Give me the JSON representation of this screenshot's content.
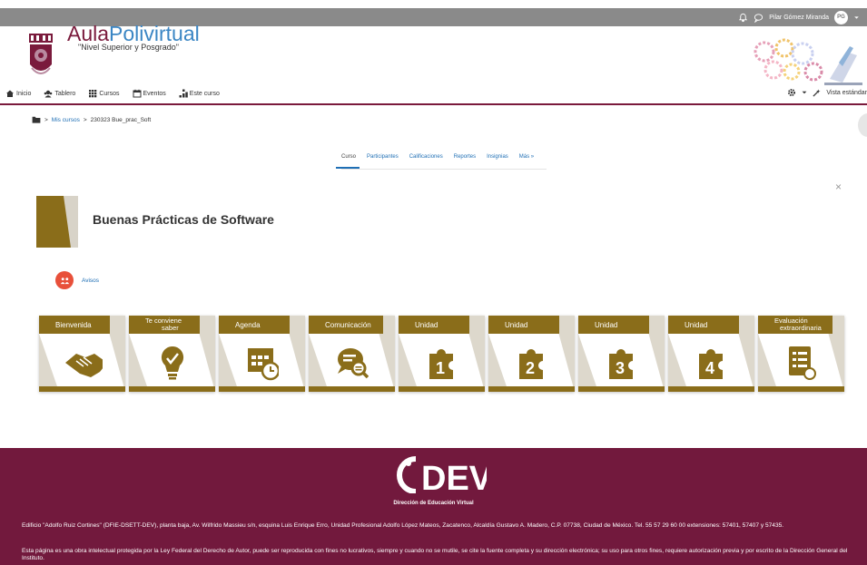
{
  "topbar": {
    "user_name": "Pilar Gómez Miranda",
    "initials": "PG"
  },
  "brand": {
    "title_part1": "Aula",
    "title_part2": "Polivirtual",
    "subtitle": "\"Nivel Superior y Posgrado\""
  },
  "nav": {
    "items": [
      {
        "label": "Inicio",
        "icon": "home-icon"
      },
      {
        "label": "Tablero",
        "icon": "dashboard-icon"
      },
      {
        "label": "Cursos",
        "icon": "grid-icon"
      },
      {
        "label": "Eventos",
        "icon": "calendar-icon"
      },
      {
        "label": "Este curso",
        "icon": "sitemap-icon"
      }
    ],
    "view_label": "Vista estándar"
  },
  "breadcrumb": {
    "mis_cursos": "Mis cursos",
    "current": "230323 Bue_prac_Soft",
    "sep": ">"
  },
  "secondary_nav": {
    "items": [
      "Curso",
      "Participantes",
      "Calificaciones",
      "Reportes",
      "Insignias",
      "Más »"
    ],
    "active": "Curso"
  },
  "course": {
    "title": "Buenas Prácticas de Software",
    "close": "×"
  },
  "avisos": {
    "label": "Avisos"
  },
  "tiles": [
    {
      "label": "Bienvenida",
      "icon": "handshake-icon"
    },
    {
      "label_1": "Te conviene",
      "label_2": "saber",
      "icon": "lightbulb-icon"
    },
    {
      "label": "Agenda",
      "icon": "calendar-clock-icon"
    },
    {
      "label": "Comunicación",
      "icon": "chat-search-icon"
    },
    {
      "label": "Unidad",
      "number": "1",
      "icon": "puzzle-1-icon"
    },
    {
      "label": "Unidad",
      "number": "2",
      "icon": "puzzle-2-icon"
    },
    {
      "label": "Unidad",
      "number": "3",
      "icon": "puzzle-3-icon"
    },
    {
      "label": "Unidad",
      "number": "4",
      "icon": "puzzle-4-icon"
    },
    {
      "label_1": "Evaluación",
      "label_2": "extraordinaria",
      "icon": "checklist-icon"
    }
  ],
  "footer": {
    "logo_text": "DEV",
    "logo_sub": "Dirección de Educación Virtual",
    "address": "Edificio \"Adolfo Ruiz Cortines\" (DFIE-DSETT-DEV), planta baja, Av. Wilfrido Massieu s/n, esquina Luis Enrique Erro, Unidad Profesional Adolfo López Mateos, Zacatenco, Alcaldía Gustavo A. Madero, C.P. 07738, Ciudad de México. Tel. 55 57 29 60 00 extensiones: 57401, 57407 y 57435.",
    "legal": "Esta página es una obra intelectual protegida por la Ley Federal del Derecho de Autor, puede ser reproducida con fines no lucrativos, siempre y cuando no se mutile, se cite la fuente completa y su dirección electrónica; su uso para otros fines, requiere autorización previa y por escrito de la Dirección General del Instituto."
  },
  "colors": {
    "maroon": "#72193d",
    "gold": "#8a6d1a",
    "link": "#1f6fb5",
    "topbar": "#8a8a8a"
  }
}
